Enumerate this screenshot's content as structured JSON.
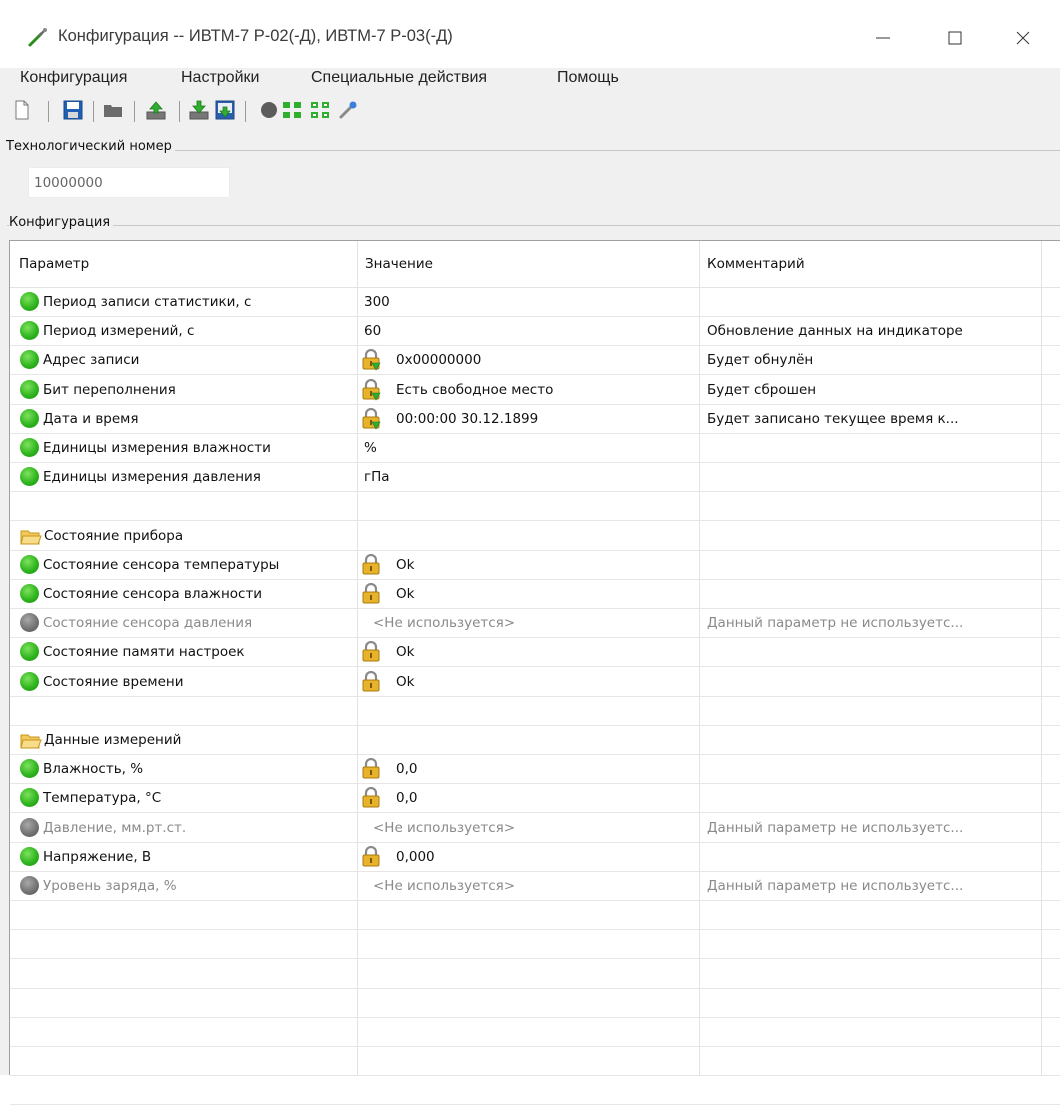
{
  "window": {
    "title": "Конфигурация -- ИВТМ-7 Р-02(-Д), ИВТМ-7 Р-03(-Д)"
  },
  "menu": [
    "Конфигурация",
    "Настройки",
    "Специальные действия",
    "Помощь"
  ],
  "tech_number": {
    "label": "Технологический номер",
    "value": "10000000"
  },
  "config_group": {
    "label": "Конфигурация"
  },
  "grid": {
    "columns": [
      "Параметр",
      "Значение",
      "Комментарий"
    ],
    "rows": [
      {
        "name": "Период записи статистики, с",
        "value": "300",
        "comment": "",
        "status": "green",
        "icon": "",
        "kind": "param"
      },
      {
        "name": "Период измерений, с",
        "value": "60",
        "comment": "Обновление данных на индикаторе",
        "status": "green",
        "icon": "",
        "kind": "param"
      },
      {
        "name": "Адрес записи",
        "value": "0x00000000",
        "comment": "Будет обнулён",
        "status": "green",
        "icon": "lock-write",
        "kind": "param"
      },
      {
        "name": "Бит переполнения",
        "value": "Есть свободное место",
        "comment": "Будет сброшен",
        "status": "green",
        "icon": "lock-write",
        "kind": "param"
      },
      {
        "name": "Дата и время",
        "value": "00:00:00 30.12.1899",
        "comment": "Будет записано текущее время к...",
        "status": "green",
        "icon": "lock-write",
        "kind": "param"
      },
      {
        "name": "Единицы измерения влажности",
        "value": "%",
        "comment": "",
        "status": "green",
        "icon": "",
        "kind": "param"
      },
      {
        "name": "Единицы измерения давления",
        "value": "гПа",
        "comment": "",
        "status": "green",
        "icon": "",
        "kind": "param"
      },
      {
        "name": "",
        "value": "",
        "comment": "",
        "status": "",
        "icon": "",
        "kind": "empty"
      },
      {
        "name": "Состояние прибора",
        "value": "",
        "comment": "",
        "status": "",
        "icon": "",
        "kind": "folder"
      },
      {
        "name": "Состояние сенсора температуры",
        "value": "Ok",
        "comment": "",
        "status": "green",
        "icon": "lock",
        "kind": "param"
      },
      {
        "name": "Состояние сенсора влажности",
        "value": "Ok",
        "comment": "",
        "status": "green",
        "icon": "lock",
        "kind": "param"
      },
      {
        "name": "Состояние сенсора давления",
        "value": "<Не используется>",
        "comment": "Данный параметр не используетс...",
        "status": "grey",
        "icon": "",
        "kind": "param"
      },
      {
        "name": "Состояние памяти настроек",
        "value": "Ok",
        "comment": "",
        "status": "green",
        "icon": "lock",
        "kind": "param"
      },
      {
        "name": "Состояние времени",
        "value": "Ok",
        "comment": "",
        "status": "green",
        "icon": "lock",
        "kind": "param"
      },
      {
        "name": "",
        "value": "",
        "comment": "",
        "status": "",
        "icon": "",
        "kind": "empty"
      },
      {
        "name": "Данные измерений",
        "value": "",
        "comment": "",
        "status": "",
        "icon": "",
        "kind": "folder"
      },
      {
        "name": "Влажность, %",
        "value": "0,0",
        "comment": "",
        "status": "green",
        "icon": "lock",
        "kind": "param"
      },
      {
        "name": "Температура, °C",
        "value": "0,0",
        "comment": "",
        "status": "green",
        "icon": "lock",
        "kind": "param"
      },
      {
        "name": "Давление, мм.рт.ст.",
        "value": "<Не используется>",
        "comment": "Данный параметр не используетс...",
        "status": "grey",
        "icon": "",
        "kind": "param"
      },
      {
        "name": "Напряжение, В",
        "value": "0,000",
        "comment": "",
        "status": "green",
        "icon": "lock",
        "kind": "param"
      },
      {
        "name": "Уровень заряда, %",
        "value": "<Не используется>",
        "comment": "Данный параметр не используетс...",
        "status": "grey",
        "icon": "",
        "kind": "param"
      },
      {
        "name": "",
        "value": "",
        "comment": "",
        "status": "",
        "icon": "",
        "kind": "empty"
      },
      {
        "name": "",
        "value": "",
        "comment": "",
        "status": "",
        "icon": "",
        "kind": "empty"
      },
      {
        "name": "",
        "value": "",
        "comment": "",
        "status": "",
        "icon": "",
        "kind": "empty"
      },
      {
        "name": "",
        "value": "",
        "comment": "",
        "status": "",
        "icon": "",
        "kind": "empty"
      },
      {
        "name": "",
        "value": "",
        "comment": "",
        "status": "",
        "icon": "",
        "kind": "empty"
      },
      {
        "name": "",
        "value": "",
        "comment": "",
        "status": "",
        "icon": "",
        "kind": "empty"
      },
      {
        "name": "",
        "value": "",
        "comment": "",
        "status": "",
        "icon": "",
        "kind": "empty"
      }
    ]
  }
}
